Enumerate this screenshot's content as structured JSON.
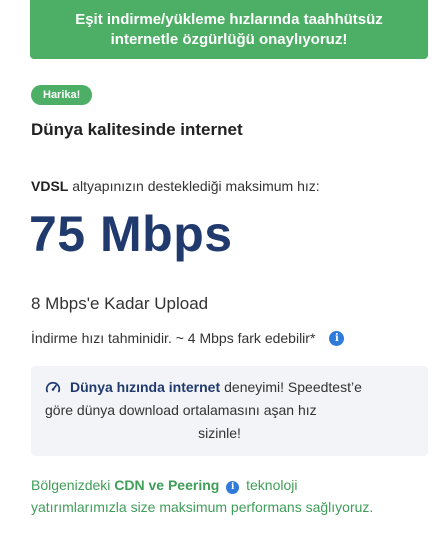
{
  "banner": {
    "line1": "Eşit indirme/yükleme hızlarında taahhütsüz",
    "line2": "internetle özgürlüğü onaylıyoruz!"
  },
  "badge": "Harika!",
  "heading": "Dünya kalitesinde internet",
  "max_speed": {
    "tech": "VDSL",
    "text": "altyapınızın desteklediği maksimum hız:"
  },
  "speed": "75 Mbps",
  "upload": "8 Mbps'e Kadar Upload",
  "estimate": {
    "text": "İndirme hızı tahminidir. ~ 4 Mbps fark edebilir*",
    "icon": "info-icon"
  },
  "world_box": {
    "icon": "gauge-icon",
    "bold": "Dünya hızında internet",
    "line1_rest": "deneyimi! Speedtest’e",
    "line2": "göre dünya download ortalamasını aşan hız",
    "line3": "sizinle!"
  },
  "cdn": {
    "prefix": "Bölgenizdeki",
    "bold": "CDN ve Peering",
    "suffix": "teknoloji",
    "line2": "yatırımlarımızla size maksimum performans sağlıyoruz."
  },
  "colors": {
    "accent_green": "#4caf65",
    "speed_navy": "#213a6e",
    "info_blue": "#2f7bd9",
    "cdn_green": "#3f9e58"
  }
}
